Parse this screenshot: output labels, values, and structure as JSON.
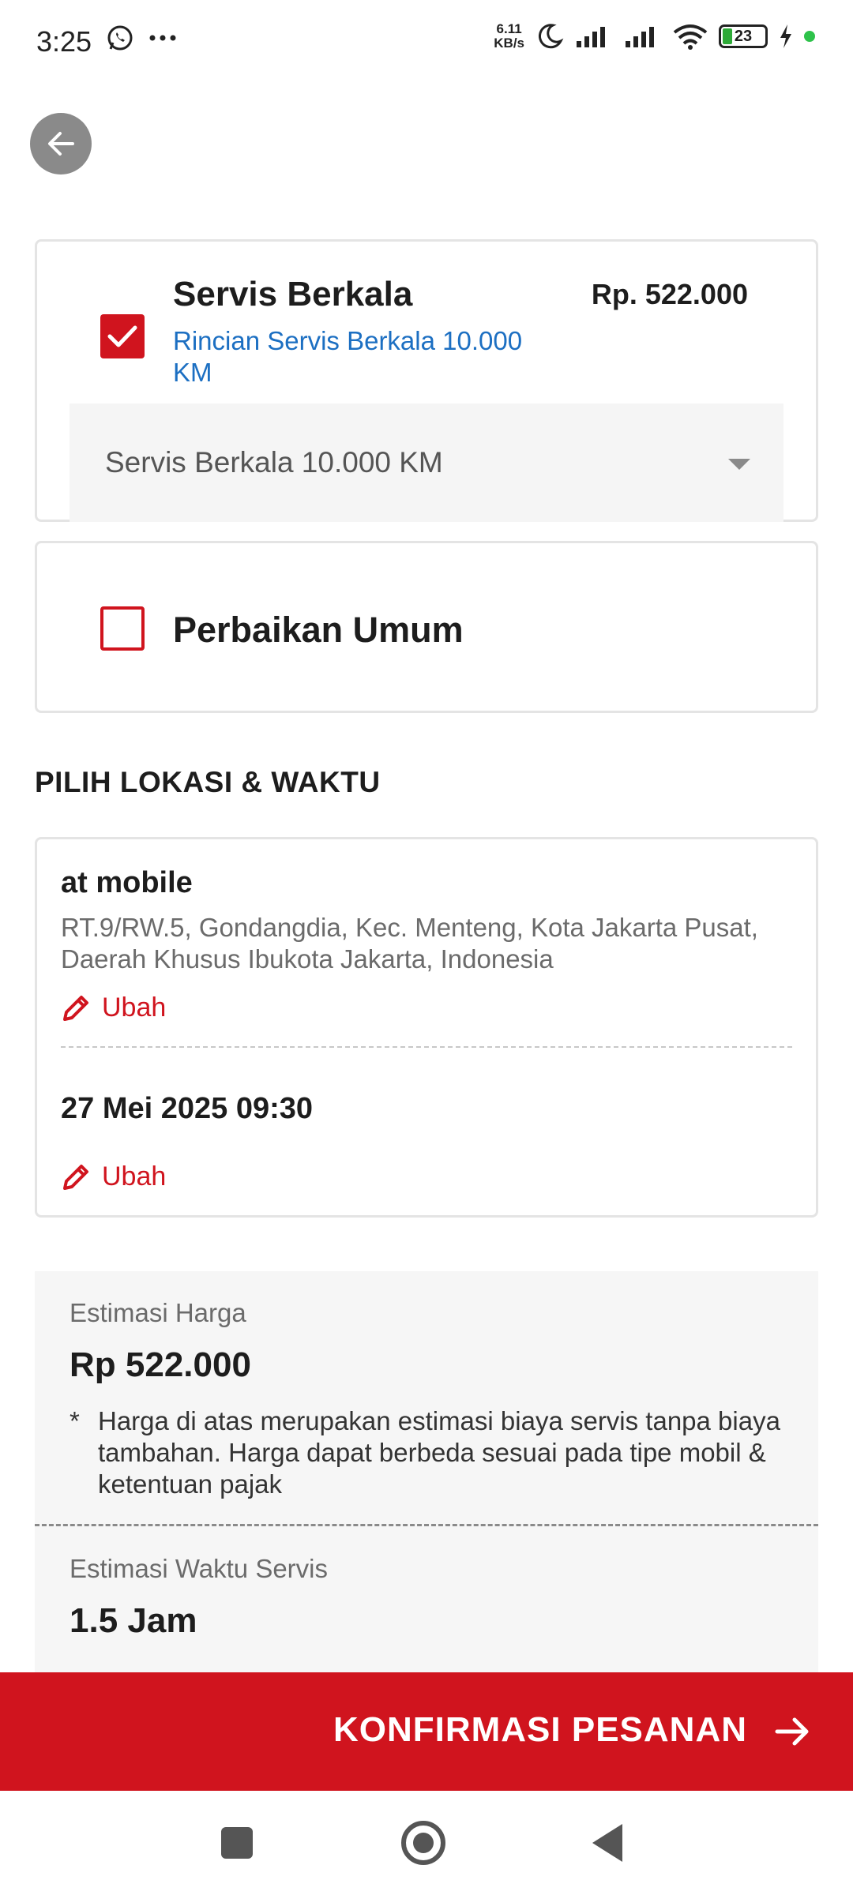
{
  "status_bar": {
    "time": "3:25",
    "net_speed_value": "6.11",
    "net_speed_unit": "KB/s",
    "battery_level": "23"
  },
  "service_card": {
    "title": "Servis Berkala",
    "price": "Rp. 522.000",
    "detail_link": "Rincian Servis Berkala 10.000 KM",
    "checked": true,
    "dropdown_value": "Servis Berkala 10.000 KM"
  },
  "repair_card": {
    "title": "Perbaikan Umum",
    "checked": false
  },
  "location_section": {
    "heading": "PILIH LOKASI & WAKTU",
    "location_name": "at mobile",
    "address": "RT.9/RW.5, Gondangdia, Kec. Menteng, Kota Jakarta Pusat, Daerah Khusus Ibukota Jakarta, Indonesia",
    "edit_label": "Ubah",
    "datetime": "27 Mei 2025 09:30",
    "edit_label_2": "Ubah"
  },
  "estimate": {
    "price_label": "Estimasi Harga",
    "price_value": "Rp 522.000",
    "note_marker": "*",
    "note": "Harga di atas merupakan estimasi biaya servis tanpa biaya tambahan. Harga dapat berbeda sesuai pada tipe mobil & ketentuan pajak",
    "time_label": "Estimasi Waktu Servis",
    "time_value": "1.5 Jam"
  },
  "confirm_button": {
    "label": "KONFIRMASI PESANAN"
  },
  "colors": {
    "accent": "#d0141e",
    "link": "#1c6fc2"
  }
}
